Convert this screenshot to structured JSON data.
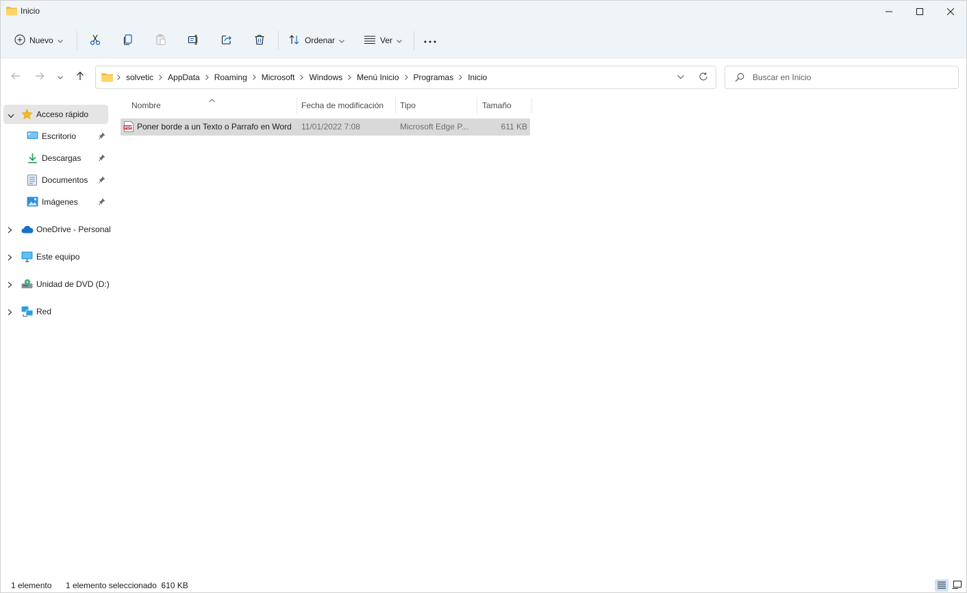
{
  "window": {
    "title": "Inicio"
  },
  "toolbar": {
    "new_label": "Nuevo",
    "sort_label": "Ordenar",
    "view_label": "Ver",
    "icons": [
      "cut-icon",
      "copy-icon",
      "paste-icon",
      "rename-icon",
      "share-icon",
      "delete-icon",
      "more-icon"
    ]
  },
  "address": {
    "crumbs": [
      "solvetic",
      "AppData",
      "Roaming",
      "Microsoft",
      "Windows",
      "Menú Inicio",
      "Programas",
      "Inicio"
    ]
  },
  "search": {
    "placeholder": "Buscar en Inicio"
  },
  "sidebar": {
    "quick_access": "Acceso rápido",
    "pinned": [
      "Escritorio",
      "Descargas",
      "Documentos",
      "Imágenes"
    ],
    "sections": [
      "OneDrive - Personal",
      "Este equipo",
      "Unidad de DVD (D:)",
      "Red"
    ]
  },
  "columns": [
    "Nombre",
    "Fecha de modificación",
    "Tipo",
    "Tamaño"
  ],
  "files": [
    {
      "name": "Poner borde a un Texto o Parrafo en Word",
      "modified": "11/01/2022 7:08",
      "type": "Microsoft Edge P...",
      "size": "611 KB",
      "icon": "pdf-icon"
    }
  ],
  "status": {
    "count": "1 elemento",
    "selection": "1 elemento seleccionado  610 KB"
  },
  "colors": {
    "accent": "#0067c0",
    "folder": "#f8c84a",
    "selected_row": "#d9d9d9",
    "chrome": "#eff4f9"
  }
}
